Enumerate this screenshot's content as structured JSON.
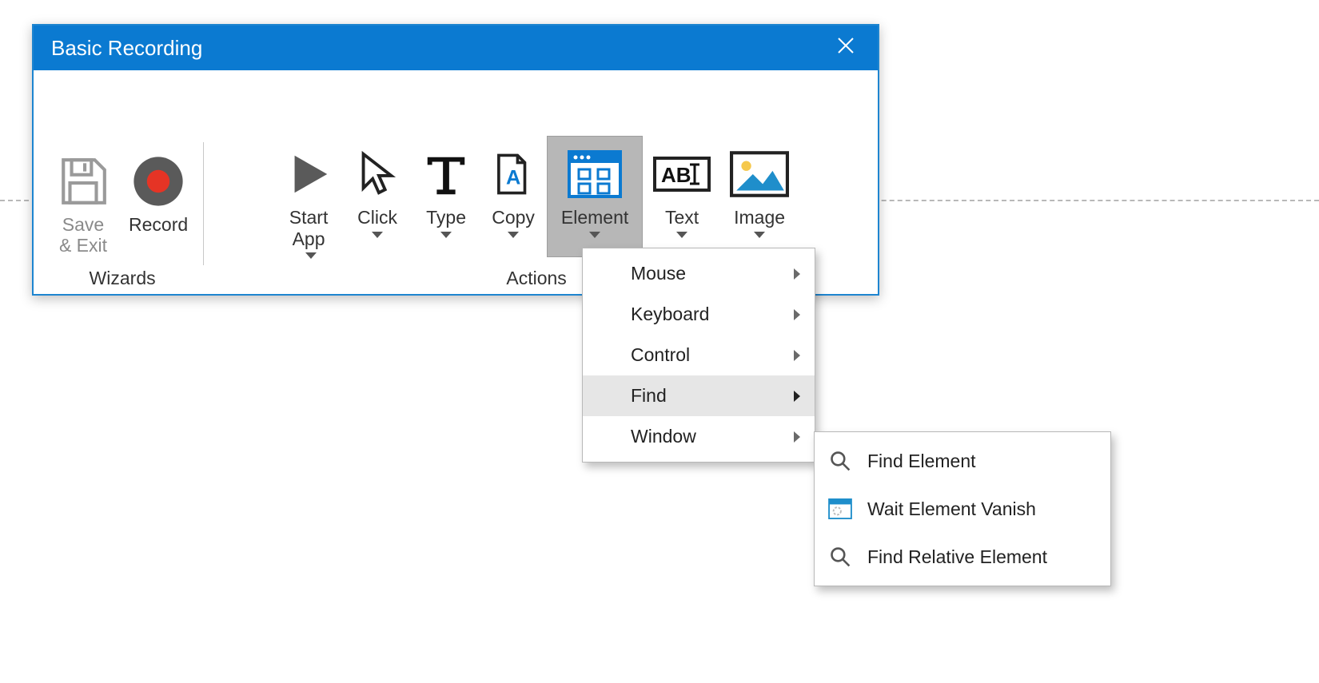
{
  "window": {
    "title": "Basic Recording"
  },
  "groups": {
    "wizards": {
      "label": "Wizards"
    },
    "actions": {
      "label": "Actions"
    }
  },
  "buttons": {
    "save_exit": "Save\n& Exit",
    "record": "Record",
    "start_app": "Start\nApp",
    "click": "Click",
    "type": "Type",
    "copy": "Copy",
    "element": "Element",
    "text": "Text",
    "image": "Image"
  },
  "element_menu": {
    "mouse": "Mouse",
    "keyboard": "Keyboard",
    "control": "Control",
    "find": "Find",
    "window": "Window"
  },
  "find_submenu": {
    "find_element": "Find Element",
    "wait_vanish": "Wait Element Vanish",
    "find_relative": "Find Relative Element"
  }
}
